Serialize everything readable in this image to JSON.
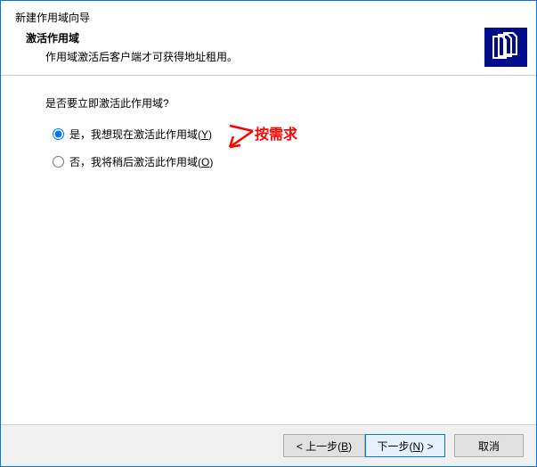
{
  "header": {
    "window_title": "新建作用域向导",
    "subtitle_bold": "激活作用域",
    "description": "作用域激活后客户端才可获得地址租用。",
    "icon_name": "scope-documents-icon"
  },
  "content": {
    "question": "是否要立即激活此作用域?",
    "options": [
      {
        "value": "yes",
        "label_main": "是，我想现在激活此作用域(",
        "access_key": "Y",
        "label_end": ")",
        "checked": true
      },
      {
        "value": "no",
        "label_main": "否，我将稍后激活此作用域(",
        "access_key": "O",
        "label_end": ")",
        "checked": false
      }
    ]
  },
  "annotation": {
    "text": "按需求"
  },
  "footer": {
    "back_label_pre": "< 上一步(",
    "back_access": "B",
    "back_label_post": ")",
    "next_label_pre": "下一步(",
    "next_access": "N",
    "next_label_post": ") >",
    "cancel_label": "取消"
  }
}
